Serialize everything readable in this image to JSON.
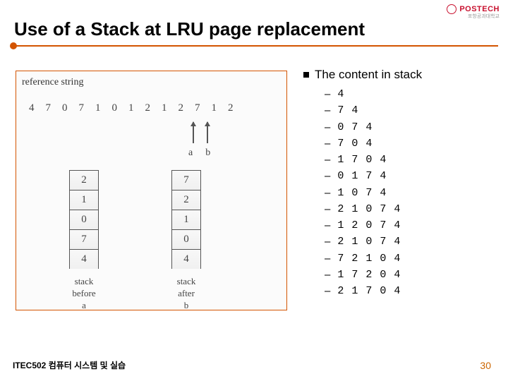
{
  "logo": {
    "text": "POSTECH",
    "sub": "포항공과대학교"
  },
  "title": "Use of a Stack at LRU page replacement",
  "figure": {
    "ref_label": "reference string",
    "ref_values": [
      "4",
      "7",
      "0",
      "7",
      "1",
      "0",
      "1",
      "2",
      "1",
      "2",
      "7",
      "1",
      "2"
    ],
    "arrow_labels": [
      "a",
      "b"
    ],
    "stack_a": {
      "cells": [
        "2",
        "1",
        "0",
        "7",
        "4"
      ],
      "label_line1": "stack",
      "label_line2": "before",
      "label_line3": "a"
    },
    "stack_b": {
      "cells": [
        "7",
        "2",
        "1",
        "0",
        "4"
      ],
      "label_line1": "stack",
      "label_line2": "after",
      "label_line3": "b"
    }
  },
  "list": {
    "header": "The content in stack",
    "items": [
      "4",
      "7 4",
      "0 7 4",
      "7 0 4",
      "1 7 0 4",
      "0 1 7 4",
      "1 0 7 4",
      "2 1 0 7 4",
      "1 2 0 7 4",
      "2 1 0 7 4",
      "7 2 1 0 4",
      "1 7 2 0 4",
      "2 1 7 0 4"
    ]
  },
  "footer": {
    "left": "ITEC502 컴퓨터 시스템 및 실습",
    "pagenum": "30"
  }
}
